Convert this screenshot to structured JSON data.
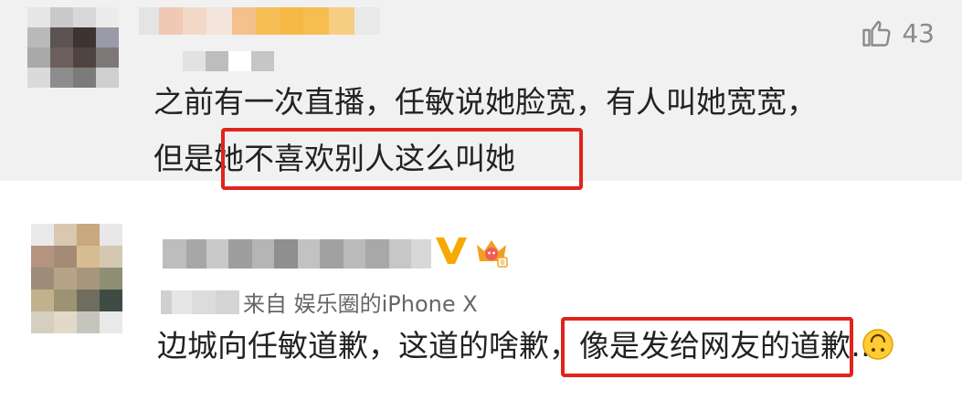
{
  "comment1": {
    "like_icon": "thumbs-up-outline-icon",
    "like_count": "43",
    "line1": "之前有一次直播，任敏说她脸宽，有人叫她宽宽，",
    "line2_prefix": "但是",
    "line2_highlight": "她不喜欢别人这么叫她"
  },
  "comment2": {
    "badges": [
      "verified-v-icon",
      "crown-membership-icon"
    ],
    "source": "来自 娱乐圈的iPhone X",
    "text_prefix": "边城向任敏道歉，这道的啥歉，",
    "text_highlight": "像是发给网友的道歉…",
    "emoji": "upside-down-face-emoji-icon"
  },
  "colors": {
    "highlight_border": "#e0241c",
    "verified_v": "#f7a900",
    "crown": "#f0a020"
  }
}
